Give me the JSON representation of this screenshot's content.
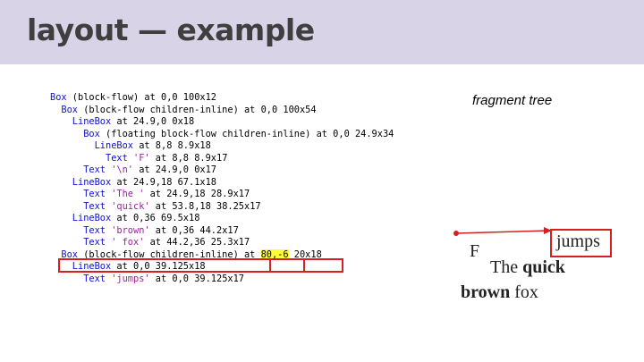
{
  "slide": {
    "title": "layout — example",
    "side_label": "fragment tree"
  },
  "tree_lines": [
    {
      "parts": [
        {
          "t": "Box",
          "c": "kw"
        },
        {
          "t": " (block-flow) at 0,0 100x12",
          "c": ""
        }
      ]
    },
    {
      "parts": [
        {
          "t": "  Box",
          "c": "kw"
        },
        {
          "t": " (block-flow children-inline) at 0,0 100x54",
          "c": ""
        }
      ]
    },
    {
      "parts": [
        {
          "t": "    LineBox",
          "c": "kw"
        },
        {
          "t": " at 24.9,0 0x18",
          "c": ""
        }
      ]
    },
    {
      "parts": [
        {
          "t": "      Box",
          "c": "kw"
        },
        {
          "t": " (floating block-flow children-inline) at 0,0 24.9x34",
          "c": ""
        }
      ]
    },
    {
      "parts": [
        {
          "t": "        LineBox",
          "c": "kw"
        },
        {
          "t": " at 8,8 8.9x18",
          "c": ""
        }
      ]
    },
    {
      "parts": [
        {
          "t": "          Text",
          "c": "kw"
        },
        {
          "t": " ",
          "c": ""
        },
        {
          "t": "'F'",
          "c": "str"
        },
        {
          "t": " at 8,8 8.9x17",
          "c": ""
        }
      ]
    },
    {
      "parts": [
        {
          "t": "      Text",
          "c": "kw"
        },
        {
          "t": " ",
          "c": ""
        },
        {
          "t": "'\\n'",
          "c": "str"
        },
        {
          "t": " at 24.9,0 0x17",
          "c": ""
        }
      ]
    },
    {
      "parts": [
        {
          "t": "    LineBox",
          "c": "kw"
        },
        {
          "t": " at 24.9,18 67.1x18",
          "c": ""
        }
      ]
    },
    {
      "parts": [
        {
          "t": "      Text",
          "c": "kw"
        },
        {
          "t": " ",
          "c": ""
        },
        {
          "t": "'The '",
          "c": "str"
        },
        {
          "t": " at 24.9,18 28.9x17",
          "c": ""
        }
      ]
    },
    {
      "parts": [
        {
          "t": "      Text",
          "c": "kw"
        },
        {
          "t": " ",
          "c": ""
        },
        {
          "t": "'quick'",
          "c": "str"
        },
        {
          "t": " at 53.8,18 38.25x17",
          "c": ""
        }
      ]
    },
    {
      "parts": [
        {
          "t": "    LineBox",
          "c": "kw"
        },
        {
          "t": " at 0,36 69.5x18",
          "c": ""
        }
      ]
    },
    {
      "parts": [
        {
          "t": "      Text",
          "c": "kw"
        },
        {
          "t": " ",
          "c": ""
        },
        {
          "t": "'brown'",
          "c": "str"
        },
        {
          "t": " at 0,36 44.2x17",
          "c": ""
        }
      ]
    },
    {
      "parts": [
        {
          "t": "      Text",
          "c": "kw"
        },
        {
          "t": " ",
          "c": ""
        },
        {
          "t": "' fox'",
          "c": "str"
        },
        {
          "t": " at 44.2,36 25.3x17",
          "c": ""
        }
      ]
    },
    {
      "parts": [
        {
          "t": "  Box",
          "c": "kw"
        },
        {
          "t": " (block-flow children-inline) at ",
          "c": ""
        },
        {
          "t": "80,-6",
          "c": "hl"
        },
        {
          "t": " 20x18",
          "c": ""
        }
      ]
    },
    {
      "parts": [
        {
          "t": "    LineBox",
          "c": "kw"
        },
        {
          "t": " at 0,0 39.125x18",
          "c": ""
        }
      ]
    },
    {
      "parts": [
        {
          "t": "      Text",
          "c": "kw"
        },
        {
          "t": " ",
          "c": ""
        },
        {
          "t": "'jumps'",
          "c": "str"
        },
        {
          "t": " at 0,0 39.125x17",
          "c": ""
        }
      ]
    }
  ],
  "render": {
    "f": "F",
    "the": "The ",
    "quick": "quick",
    "brown": "brown",
    "fox": " fox",
    "jumps": "jumps"
  },
  "colors": {
    "header_bg": "#d9d3e8",
    "keyword": "#1010d0",
    "string": "#a020a0",
    "highlight": "#ffff33",
    "annotation_red": "#d42020"
  }
}
